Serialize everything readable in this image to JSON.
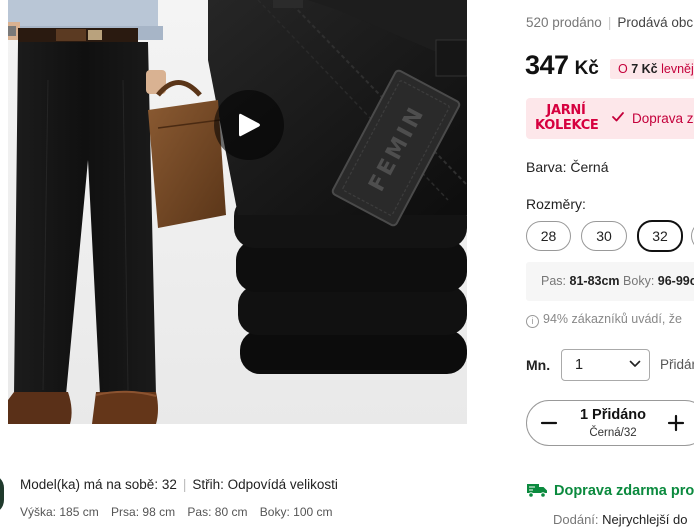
{
  "model_info": {
    "worn_size": "Model(ka) má na sobě: 32",
    "fit": "Střih: Odpovídá velikosti",
    "measurements": [
      "Výška: 185 cm",
      "Prsa: 98 cm",
      "Pas: 80 cm",
      "Boky: 100 cm"
    ]
  },
  "product": {
    "label_text": "FEMIN",
    "sold": "520 prodáno",
    "store": "Prodává obc",
    "price_amount": "347",
    "price_currency": "Kč",
    "discount_prefix": "O",
    "discount_value": "7 Kč",
    "discount_suffix": "levnějš",
    "promo_line1": "JARNÍ",
    "promo_line2": "KOLEKCE",
    "promo_text": "Doprava z",
    "color_label": "Barva: Černá",
    "sizes_label": "Rozměry:",
    "sizes": [
      "28",
      "30",
      "32"
    ],
    "selected_size": "32",
    "measure_pas_label": "Pas:",
    "measure_pas_value": "81-83cm",
    "measure_boky_label": "Boky:",
    "measure_boky_value": "96-99c",
    "fit_info": "94% zákazníků uvádí, že",
    "qty_label": "Mn.",
    "qty_value": "1",
    "qty_side_text": "Přidán",
    "stepper_added": "1 Přidáno",
    "stepper_variant": "Černá/32",
    "shipping": "Doprava zdarma pro",
    "delivery_label": "Dodání:",
    "delivery_value": "Nejrychlejší do"
  },
  "colors": {
    "accent_red": "#d6003f",
    "promo_bg": "#fde7ea",
    "shipping_green": "#0b8a3e"
  },
  "icons": {
    "play": "play-icon",
    "check": "check-icon",
    "chevron": "chevron-down-icon",
    "minus": "minus-icon",
    "plus": "plus-icon",
    "truck": "truck-icon",
    "info": "info-icon"
  }
}
